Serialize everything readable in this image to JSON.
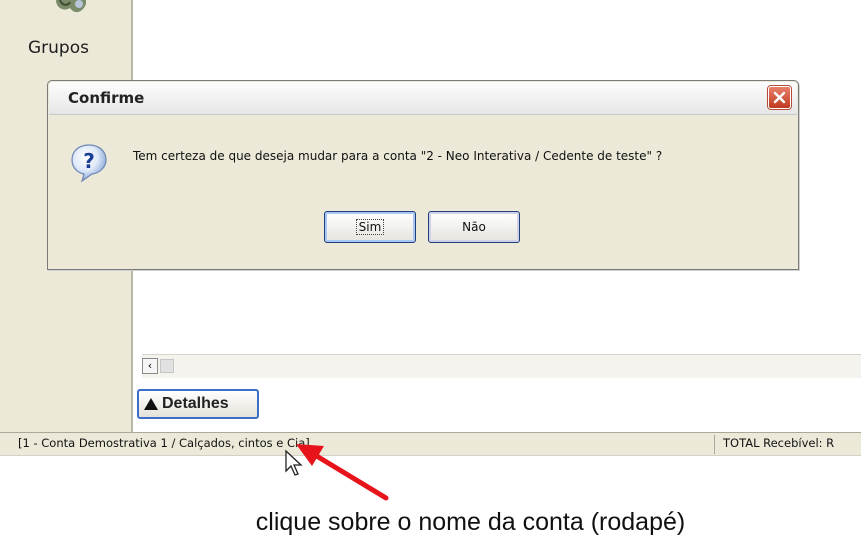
{
  "sidebar": {
    "grupos_label": "Grupos",
    "icon": "people-group-icon"
  },
  "dialog": {
    "title": "Confirme",
    "message": "Tem certeza de que deseja mudar para a conta \"2 - Neo Interativa / Cedente de teste\" ?",
    "yes_label": "Sim",
    "no_label": "Não",
    "icon": "question-icon",
    "close_icon": "close-icon"
  },
  "detail_button": {
    "label": "Detalhes",
    "icon": "triangle-up-icon"
  },
  "statusbar": {
    "account": "[1 - Conta Demostrativa 1 / Calçados, cintos e Cia]",
    "total": "TOTAL Recebível: R"
  },
  "annotation": {
    "text": "clique sobre o nome da conta (rodapé)",
    "arrow_color": "#e8141b"
  }
}
